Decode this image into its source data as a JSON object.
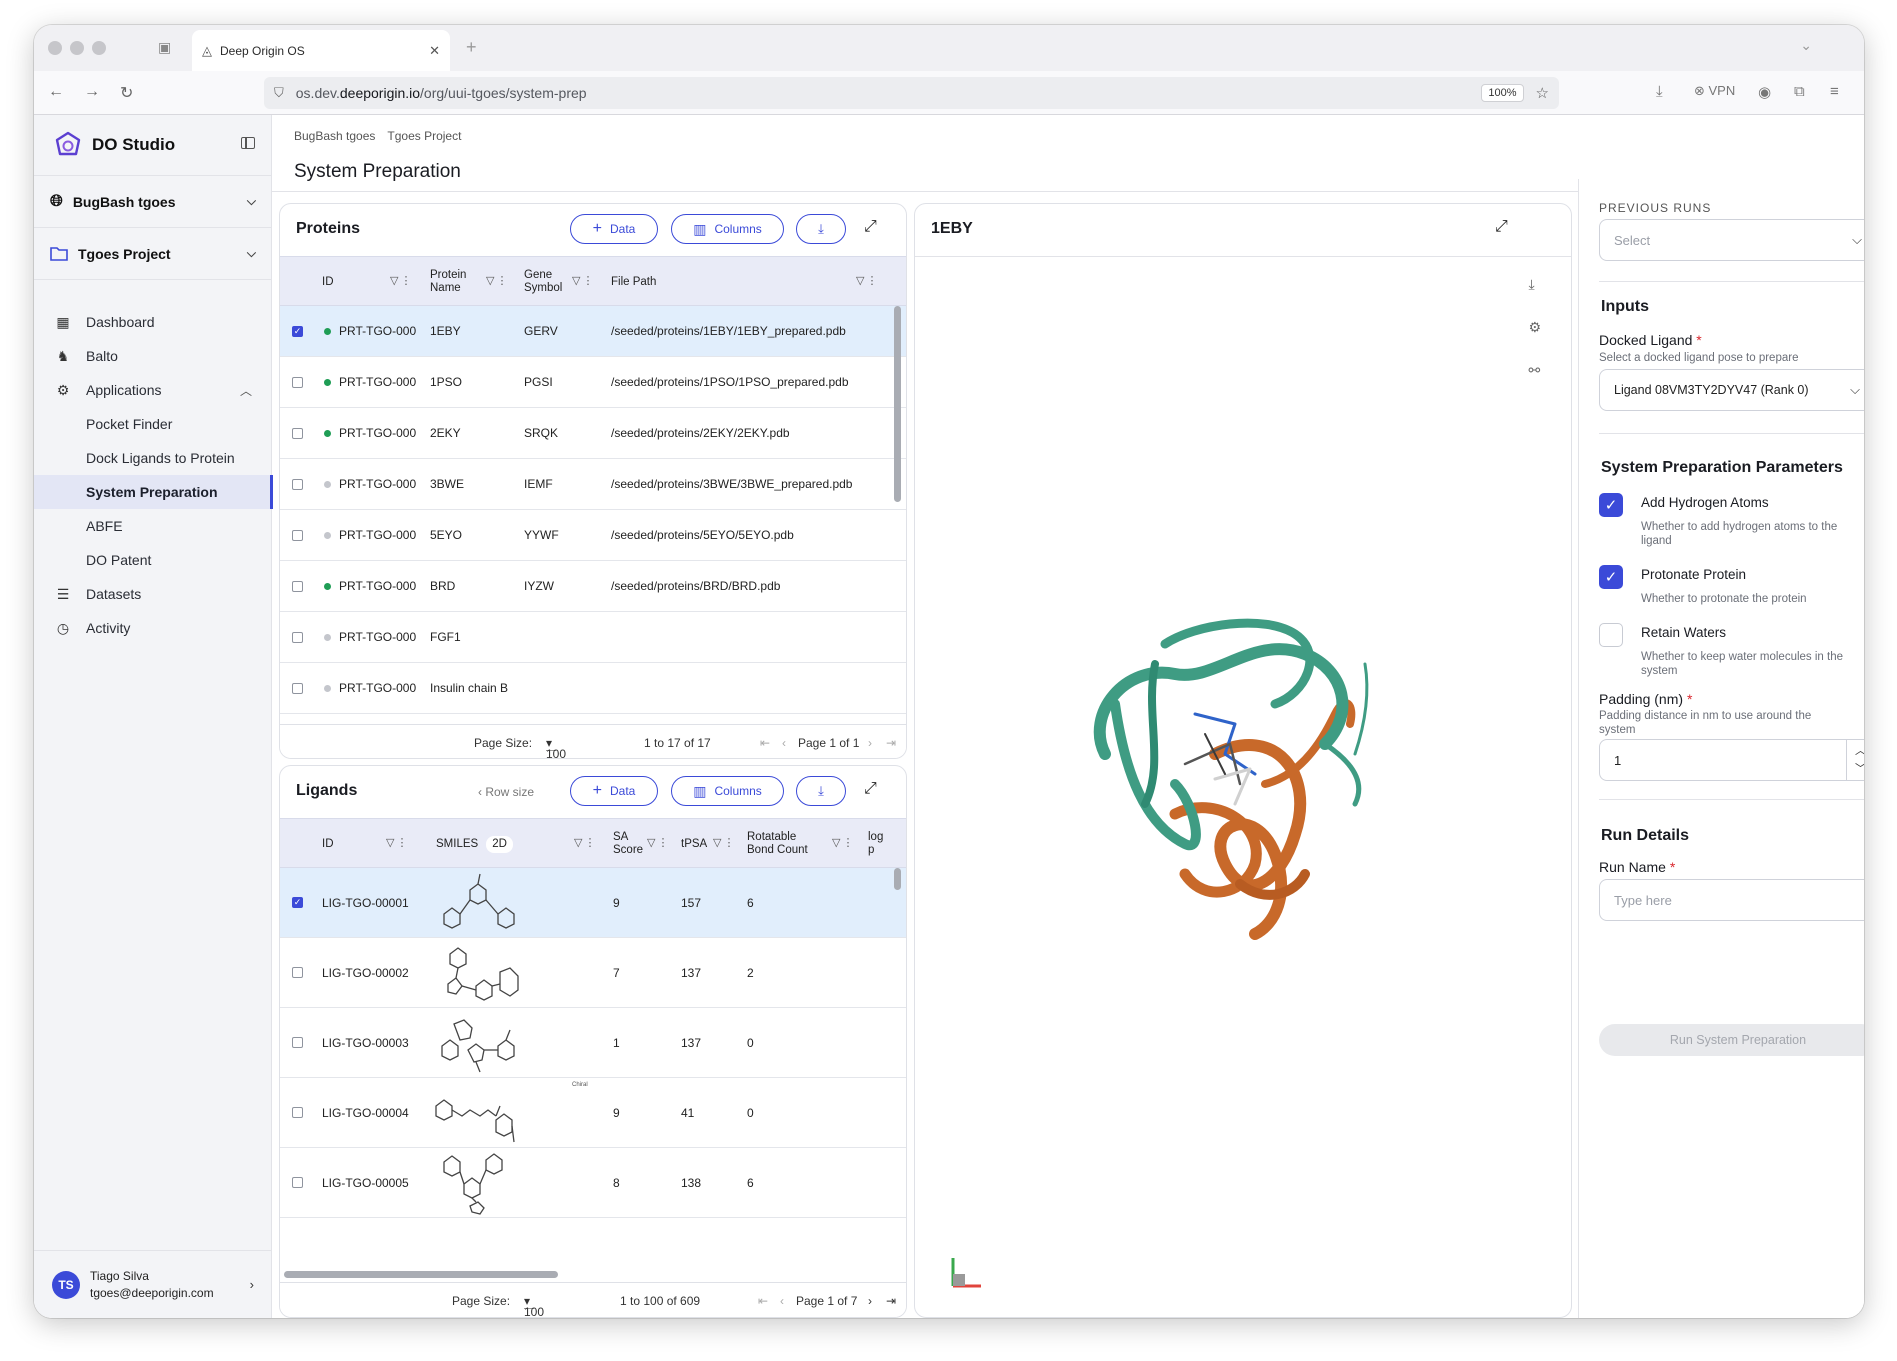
{
  "browser": {
    "tab_title": "Deep Origin OS",
    "url_prefix": "os.dev.",
    "url_domain": "deeporigin.io",
    "url_path": "/org/uui-tgoes/system-prep",
    "zoom": "100%",
    "vpn_label": "VPN"
  },
  "sidebar": {
    "brand": "DO Studio",
    "org": "BugBash tgoes",
    "project": "Tgoes Project",
    "items": [
      {
        "label": "Dashboard",
        "icon": "grid-icon"
      },
      {
        "label": "Balto",
        "icon": "dog-icon"
      },
      {
        "label": "Applications",
        "icon": "apps-icon"
      },
      {
        "label": "Pocket Finder"
      },
      {
        "label": "Dock Ligands to Protein"
      },
      {
        "label": "System Preparation"
      },
      {
        "label": "ABFE"
      },
      {
        "label": "DO Patent"
      },
      {
        "label": "Datasets",
        "icon": "database-icon"
      },
      {
        "label": "Activity",
        "icon": "clock-icon"
      }
    ],
    "user": {
      "initials": "TS",
      "name": "Tiago Silva",
      "email": "tgoes@deeporigin.com"
    }
  },
  "breadcrumb": [
    "BugBash tgoes",
    "Tgoes Project"
  ],
  "page_title": "System Preparation",
  "proteins": {
    "title": "Proteins",
    "data_btn": "Data",
    "columns_btn": "Columns",
    "headers": {
      "id": "ID",
      "name": "Protein Name",
      "gene": "Gene Symbol",
      "path": "File Path"
    },
    "rows": [
      {
        "id": "PRT-TGO-000",
        "name": "1EBY",
        "gene": "GERV",
        "path": "/seeded/proteins/1EBY/1EBY_prepared.pdb",
        "status": "green",
        "selected": true
      },
      {
        "id": "PRT-TGO-000",
        "name": "1PSO",
        "gene": "PGSI",
        "path": "/seeded/proteins/1PSO/1PSO_prepared.pdb",
        "status": "green",
        "selected": false
      },
      {
        "id": "PRT-TGO-000",
        "name": "2EKY",
        "gene": "SRQK",
        "path": "/seeded/proteins/2EKY/2EKY.pdb",
        "status": "green",
        "selected": false
      },
      {
        "id": "PRT-TGO-000",
        "name": "3BWE",
        "gene": "IEMF",
        "path": "/seeded/proteins/3BWE/3BWE_prepared.pdb",
        "status": "grey",
        "selected": false
      },
      {
        "id": "PRT-TGO-000",
        "name": "5EYO",
        "gene": "YYWF",
        "path": "/seeded/proteins/5EYO/5EYO.pdb",
        "status": "grey",
        "selected": false
      },
      {
        "id": "PRT-TGO-000",
        "name": "BRD",
        "gene": "IYZW",
        "path": "/seeded/proteins/BRD/BRD.pdb",
        "status": "green",
        "selected": false
      },
      {
        "id": "PRT-TGO-000",
        "name": "FGF1",
        "gene": "",
        "path": "",
        "status": "grey",
        "selected": false
      },
      {
        "id": "PRT-TGO-000",
        "name": "Insulin chain B",
        "gene": "",
        "path": "",
        "status": "grey",
        "selected": false
      }
    ],
    "footer": {
      "page_size_label": "Page Size:",
      "page_size": "100",
      "range": "1 to 17 of 17",
      "page": "Page 1 of 1"
    }
  },
  "ligands": {
    "title": "Ligands",
    "row_size": "Row size",
    "data_btn": "Data",
    "columns_btn": "Columns",
    "headers": {
      "id": "ID",
      "smiles": "SMILES",
      "smiles_badge": "2D",
      "sa": "SA Score",
      "tpsa": "tPSA",
      "rot": "Rotatable Bond Count",
      "logp": "log p"
    },
    "rows": [
      {
        "id": "LIG-TGO-00001",
        "sa": "9",
        "tpsa": "157",
        "rot": "6",
        "selected": true
      },
      {
        "id": "LIG-TGO-00002",
        "sa": "7",
        "tpsa": "137",
        "rot": "2",
        "selected": false
      },
      {
        "id": "LIG-TGO-00003",
        "sa": "1",
        "tpsa": "137",
        "rot": "0",
        "selected": false
      },
      {
        "id": "LIG-TGO-00004",
        "sa": "9",
        "tpsa": "41",
        "rot": "0",
        "selected": false,
        "annotation": "Chiral"
      },
      {
        "id": "LIG-TGO-00005",
        "sa": "8",
        "tpsa": "138",
        "rot": "6",
        "selected": false
      }
    ],
    "footer": {
      "page_size_label": "Page Size:",
      "page_size": "100",
      "range": "1 to 100 of 609",
      "page": "Page 1 of 7"
    }
  },
  "viewer": {
    "title": "1EBY"
  },
  "right": {
    "previous_runs_label": "PREVIOUS RUNS",
    "previous_runs_placeholder": "Select",
    "inputs_title": "Inputs",
    "docked_ligand_label": "Docked Ligand",
    "docked_ligand_help": "Select a docked ligand pose to prepare",
    "docked_ligand_value": "Ligand 08VM3TY2DYV47 (Rank 0)",
    "params_title": "System Preparation Parameters",
    "params": [
      {
        "label": "Add Hydrogen Atoms",
        "help": "Whether to add hydrogen atoms to the ligand",
        "checked": true
      },
      {
        "label": "Protonate Protein",
        "help": "Whether to protonate the protein",
        "checked": true
      },
      {
        "label": "Retain Waters",
        "help": "Whether to keep water molecules in the system",
        "checked": false
      }
    ],
    "padding_label": "Padding (nm)",
    "padding_help": "Padding distance in nm to use around the system",
    "padding_value": "1",
    "run_details_title": "Run Details",
    "run_name_label": "Run Name",
    "run_name_placeholder": "Type here",
    "run_button": "Run System Preparation",
    "required_mark": "*"
  },
  "colors": {
    "accent": "#3b4ad8",
    "green": "#1f9d55",
    "grey": "#c4c6cc",
    "ribbon_teal": "#3f9c83",
    "ribbon_orange": "#c8692a"
  }
}
